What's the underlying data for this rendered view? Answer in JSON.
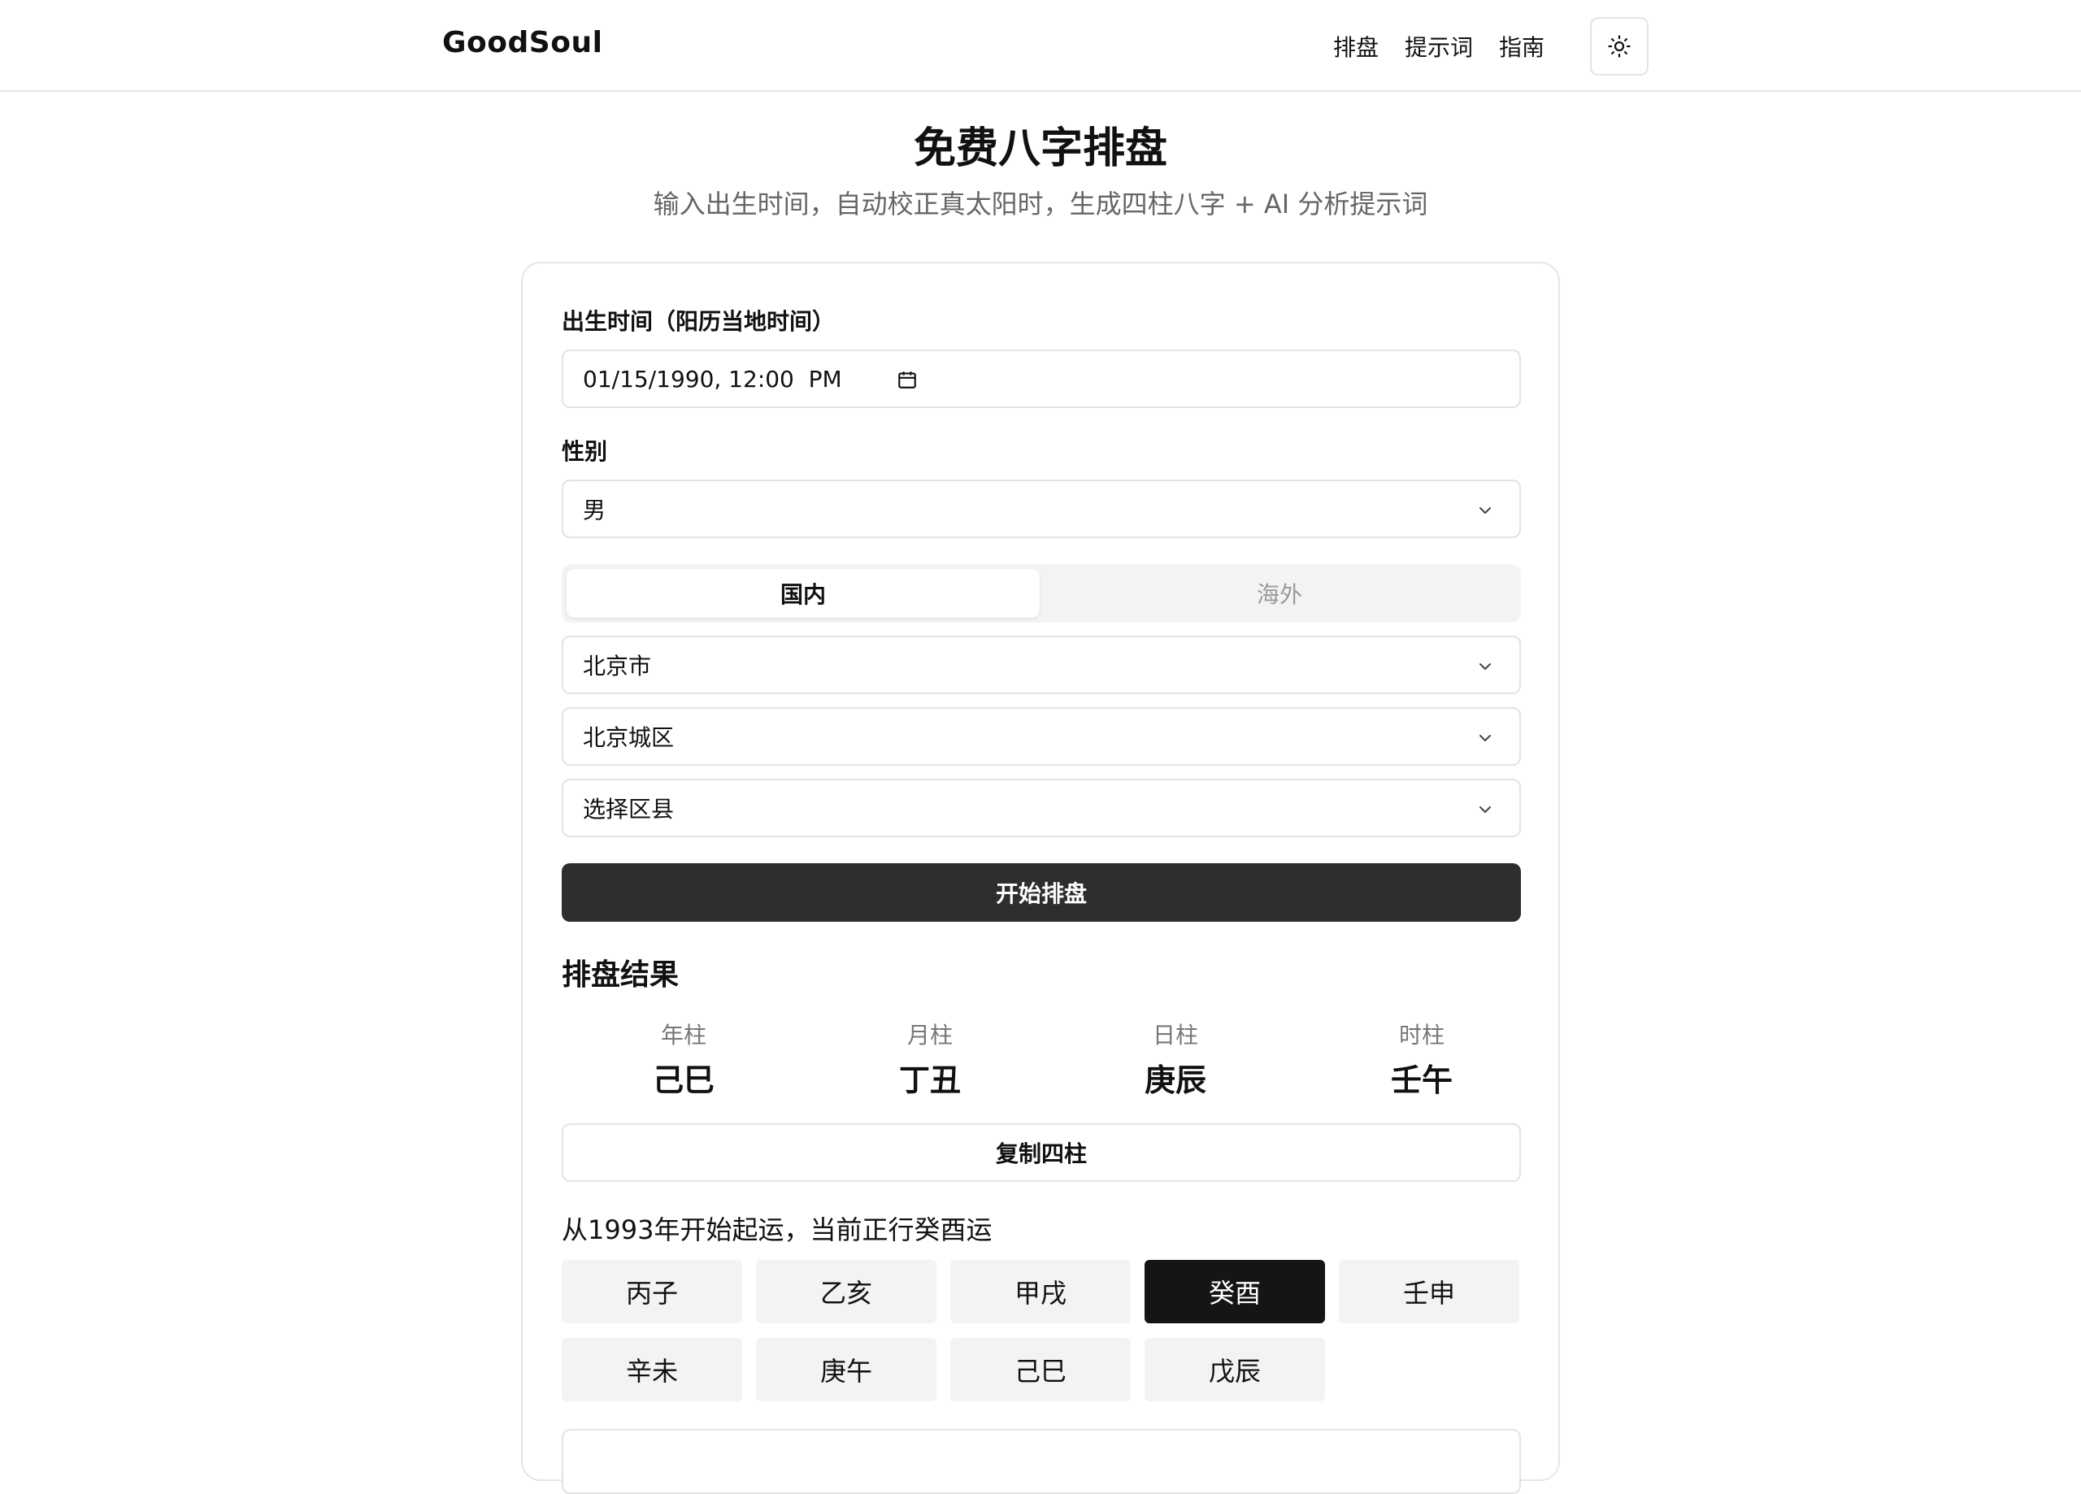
{
  "header": {
    "brand": "GoodSoul",
    "nav": [
      "排盘",
      "提示词",
      "指南"
    ],
    "theme_icon": "sun-icon"
  },
  "hero": {
    "title": "免费八字排盘",
    "subtitle": "输入出生时间，自动校正真太阳时，生成四柱八字 + AI 分析提示词"
  },
  "form": {
    "birth_label": "出生时间（阳历当地时间）",
    "birth_value": "01/15/1990, 12:00  PM",
    "gender_label": "性别",
    "gender_value": "男",
    "location_tabs": {
      "active": "国内",
      "inactive": "海外"
    },
    "province": "北京市",
    "city": "北京城区",
    "district": "选择区县",
    "submit": "开始排盘"
  },
  "result": {
    "title": "排盘结果",
    "pillars": [
      {
        "name": "年柱",
        "value": "己巳"
      },
      {
        "name": "月柱",
        "value": "丁丑"
      },
      {
        "name": "日柱",
        "value": "庚辰"
      },
      {
        "name": "时柱",
        "value": "壬午"
      }
    ],
    "copy_button": "复制四柱",
    "luck_text": "从1993年开始起运，当前正行癸酉运",
    "luck_cycles": [
      "丙子",
      "乙亥",
      "甲戌",
      "癸酉",
      "壬申",
      "辛未",
      "庚午",
      "己巳",
      "戊辰"
    ],
    "active_luck": "癸酉"
  },
  "colors": {
    "primary_button": "#2e2e2e",
    "active_luck": "#151515",
    "cell_bg": "#f3f3f3",
    "border": "#e3e3e3"
  }
}
